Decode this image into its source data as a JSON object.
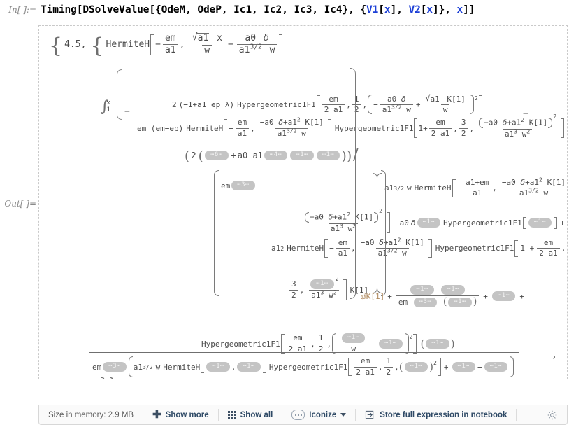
{
  "input_cell": {
    "label": "In[ ]:=",
    "tokens": [
      {
        "t": "Timing[DSolveValue[{OdeM, OdeP, Ic1, Ic2, Ic3, Ic4}, {",
        "c": "black"
      },
      {
        "t": "V1",
        "c": "blue"
      },
      {
        "t": "[",
        "c": "black"
      },
      {
        "t": "x",
        "c": "blue"
      },
      {
        "t": "], ",
        "c": "black"
      },
      {
        "t": "V2",
        "c": "blue"
      },
      {
        "t": "[",
        "c": "black"
      },
      {
        "t": "x",
        "c": "blue"
      },
      {
        "t": "]}, ",
        "c": "black"
      },
      {
        "t": "x",
        "c": "blue"
      },
      {
        "t": "]]",
        "c": "black"
      }
    ],
    "plain": "Timing[DSolveValue[{OdeM, OdeP, Ic1, Ic2, Ic3, Ic4}, {V1[x], V2[x]}, x]]"
  },
  "output_cell": {
    "label": "Out[ ]=",
    "timing_seconds": "4.5",
    "symbols": {
      "em": "em",
      "ep": "ep",
      "a0": "a0",
      "a1": "a1",
      "w": "w",
      "x": "x",
      "delta": "δ",
      "lambda": "λ",
      "K1": "K[1]",
      "dK1": "ⅆK[1]",
      "HermiteH": "HermiteH",
      "Hypergeometric1F1": "Hypergeometric1F1"
    },
    "elisions": {
      "e1": "⋯1⋯",
      "e3": "⋯3⋯",
      "e4": "⋯4⋯",
      "e6": "⋯6⋯"
    },
    "lines": {
      "l1_open": "{",
      "l1_timing": "4.5,",
      "l1_brace2": "{",
      "l1_hermite": "HermiteH",
      "integral_lower": "1",
      "integral_upper": "x",
      "num_coeff": "2",
      "num_paren": "(−1+a1 ep λ)",
      "em_emep": "em (em−ep)",
      "two": "2",
      "a0a1": "a0 a1",
      "one_plus": "1+",
      "three_halves_num": "3",
      "three_halves_den": "2",
      "half_num": "1",
      "half_den": "2"
    }
  },
  "toolbar": {
    "size_label": "Size in memory: 2.9 MB",
    "show_more": "Show more",
    "show_all": "Show all",
    "iconize": "Iconize",
    "store_full": "Store full expression in notebook",
    "icons": {
      "plus": "plus-icon",
      "grid": "grid-icon",
      "dots": "dots-icon",
      "caret": "caret-down-icon",
      "arrow_into_box": "arrow-into-box-icon",
      "gear": "gear-icon"
    }
  },
  "colors": {
    "accent_blue": "#1c3fd6",
    "toolbar_text": "#3d4f63",
    "math_gray": "#4a4a4a",
    "elide_bg": "#c4c4c4"
  }
}
